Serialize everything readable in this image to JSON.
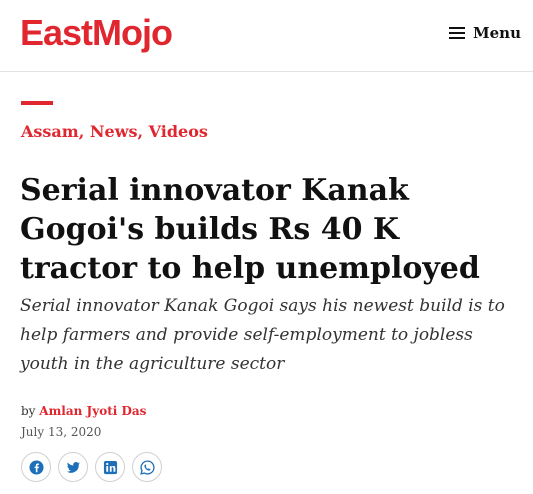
{
  "header": {
    "logo_text": "EastMojo",
    "menu_label": "Menu"
  },
  "colors": {
    "accent": "#e0262f",
    "text": "#111111",
    "share_icon": "#1d6fb8"
  },
  "article": {
    "categories": [
      "Assam",
      "News",
      "Videos"
    ],
    "category_separator": ",",
    "title": "Serial innovator Kanak Gogoi's builds Rs 40 K tractor to help unemployed",
    "subtitle": "Serial innovator Kanak Gogoi says his newest build is to help farmers and provide self-employment to jobless youth in the agriculture sector",
    "byline_prefix": "by",
    "author": "Amlan Jyoti Das",
    "date": "July 13, 2020"
  },
  "share": [
    {
      "name": "facebook-icon"
    },
    {
      "name": "twitter-icon"
    },
    {
      "name": "linkedin-icon"
    },
    {
      "name": "whatsapp-icon"
    }
  ]
}
